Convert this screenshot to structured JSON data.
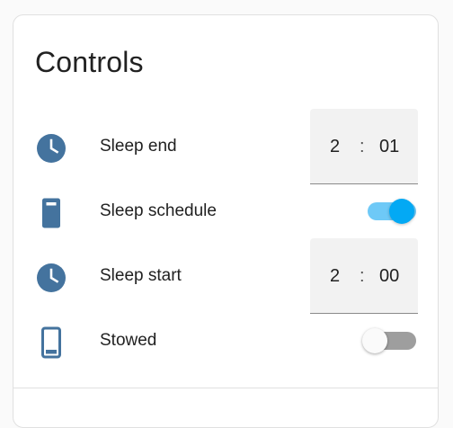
{
  "card": {
    "title": "Controls"
  },
  "rows": [
    {
      "label": "Sleep end",
      "icon": "clock-icon",
      "control": "time",
      "hour": "2",
      "separator": ":",
      "minute": "01"
    },
    {
      "label": "Sleep schedule",
      "icon": "tablet-icon",
      "control": "toggle",
      "state": "on"
    },
    {
      "label": "Sleep start",
      "icon": "clock-icon",
      "control": "time",
      "hour": "2",
      "separator": ":",
      "minute": "00"
    },
    {
      "label": "Stowed",
      "icon": "phone-outline-icon",
      "control": "toggle",
      "state": "off"
    }
  ],
  "colors": {
    "icon": "#44739e",
    "accent": "#03a9f4",
    "text": "#212121"
  }
}
